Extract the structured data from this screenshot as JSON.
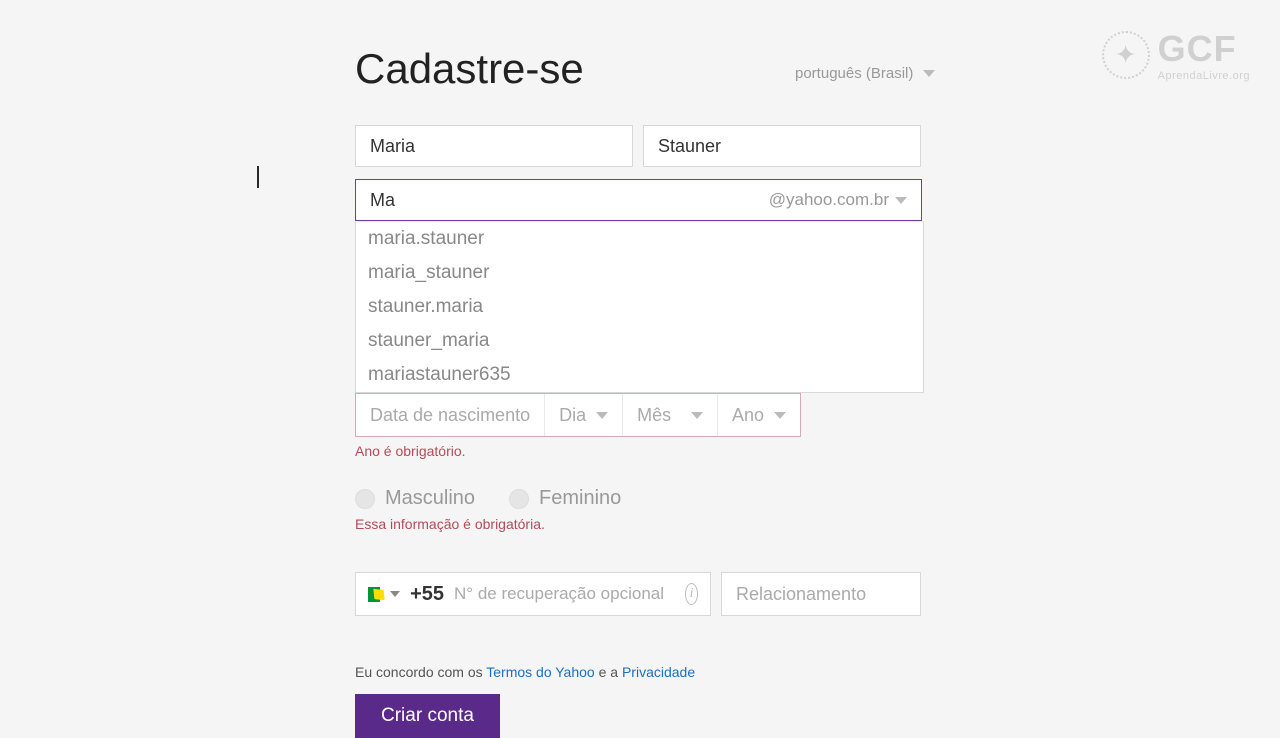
{
  "logo": {
    "main": "GCF",
    "sub": "AprendaLivre.org"
  },
  "header": {
    "title": "Cadastre-se",
    "language": "português (Brasil)"
  },
  "name": {
    "first": "Maria",
    "last": "Stauner"
  },
  "email": {
    "value": "Ma",
    "domain": "@yahoo.com.br",
    "suggestions": [
      "maria.stauner",
      "maria_stauner",
      "stauner.maria",
      "stauner_maria",
      "mariastauner635"
    ]
  },
  "dob": {
    "label": "Data de nascimento",
    "day_label": "Dia",
    "month_label": "Mês",
    "year_label": "Ano",
    "error": "Ano é obrigatório."
  },
  "gender": {
    "male": "Masculino",
    "female": "Feminino",
    "error": "Essa informação é obrigatória."
  },
  "phone": {
    "country_code": "+55",
    "placeholder": "N° de recuperação opcional"
  },
  "relation": {
    "placeholder": "Relacionamento"
  },
  "terms": {
    "prefix": "Eu concordo com os ",
    "link1": "Termos do Yahoo",
    "mid": " e a ",
    "link2": "Privacidade"
  },
  "submit": {
    "label": "Criar conta"
  }
}
